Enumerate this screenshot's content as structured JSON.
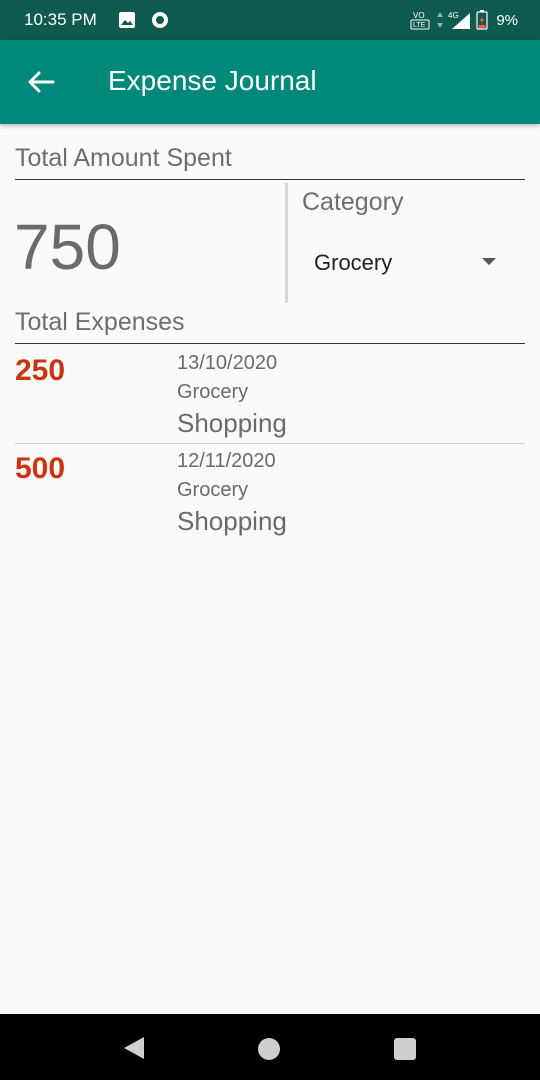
{
  "status_bar": {
    "time": "10:35 PM",
    "battery": "9%",
    "network": "4G",
    "volte": "LTE"
  },
  "app_bar": {
    "title": "Expense Journal",
    "color": "#00897b"
  },
  "summary": {
    "total_label": "Total Amount Spent",
    "total_value": "750",
    "category_label": "Category",
    "category_value": "Grocery"
  },
  "expenses_section": {
    "label": "Total Expenses",
    "items": [
      {
        "amount": "250",
        "date": "13/10/2020",
        "category": "Grocery",
        "description": "Shopping"
      },
      {
        "amount": "500",
        "date": "12/11/2020",
        "category": "Grocery",
        "description": "Shopping"
      }
    ]
  },
  "colors": {
    "amount": "#cc3311",
    "status_bar": "#0e5a4f"
  }
}
